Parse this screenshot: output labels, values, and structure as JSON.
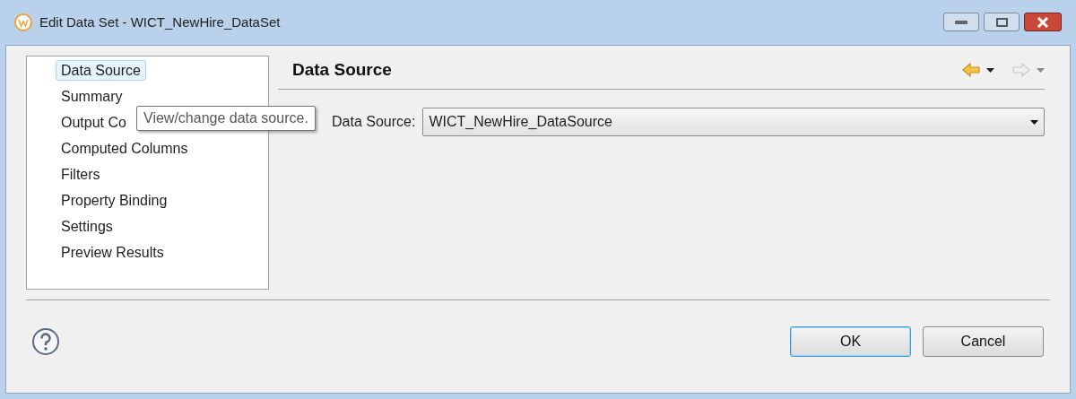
{
  "window": {
    "title": "Edit Data Set - WICT_NewHire_DataSet"
  },
  "nav": {
    "items": [
      {
        "label": "Data Source",
        "selected": true
      },
      {
        "label": "Summary",
        "selected": false
      },
      {
        "label": "Output Co",
        "selected": false
      },
      {
        "label": "Computed Columns",
        "selected": false
      },
      {
        "label": "Filters",
        "selected": false
      },
      {
        "label": "Property Binding",
        "selected": false
      },
      {
        "label": "Settings",
        "selected": false
      },
      {
        "label": "Preview Results",
        "selected": false
      }
    ]
  },
  "tooltip": "View/change data source.",
  "page": {
    "title": "Data Source",
    "back_enabled": true,
    "forward_enabled": false
  },
  "field": {
    "label": "Data Source:",
    "value": "WICT_NewHire_DataSource"
  },
  "buttons": [
    {
      "label": "OK",
      "default": true
    },
    {
      "label": "Cancel",
      "default": false
    }
  ]
}
